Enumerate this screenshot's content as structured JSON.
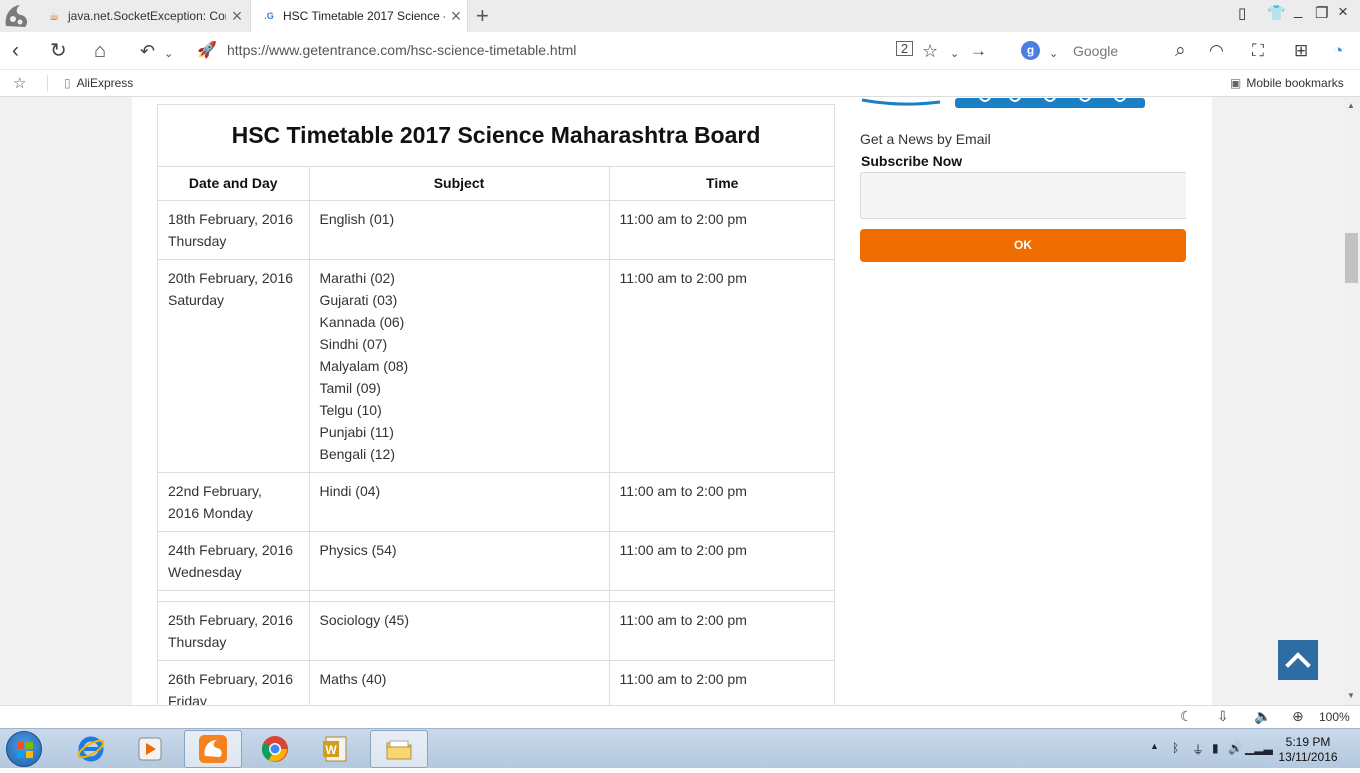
{
  "browser": {
    "tabs": [
      {
        "title": "java.net.SocketException: Cor",
        "favicon": "java-icon"
      },
      {
        "title": "HSC Timetable 2017 Science -",
        "favicon": "getentrance-icon"
      }
    ],
    "url": "https://www.getentrance.com/hsc-science-timetable.html",
    "search_engine_label": "Google",
    "search_engine_letter": "g",
    "tab_counter": "2",
    "bookmarks": [
      "AliExpress"
    ],
    "mobile_bookmarks": "Mobile bookmarks",
    "zoom": "100%"
  },
  "page": {
    "table_title": "HSC Timetable 2017 Science Maharashtra Board",
    "columns": [
      "Date and Day",
      "Subject",
      "Time"
    ],
    "rows": [
      {
        "date": "18th February, 2016",
        "day": "Thursday",
        "subjects": [
          "English (01)"
        ],
        "time": "11:00 am to 2:00 pm"
      },
      {
        "date": "20th February, 2016",
        "day": "Saturday",
        "subjects": [
          "Marathi (02)",
          "Gujarati (03)",
          "Kannada (06)",
          "Sindhi (07)",
          "Malyalam (08)",
          "Tamil (09)",
          "Telgu (10)",
          "Punjabi (11)",
          "Bengali (12)"
        ],
        "time": "11:00 am to 2:00 pm"
      },
      {
        "date": "22nd February,",
        "day": "2016 Monday",
        "subjects": [
          "Hindi (04)"
        ],
        "time": "11:00 am to 2:00 pm"
      },
      {
        "date": "24th February, 2016",
        "day": "Wednesday",
        "subjects": [
          "Physics (54)"
        ],
        "time": "11:00 am to 2:00 pm"
      },
      {
        "date": "25th February, 2016",
        "day": "Thursday",
        "subjects": [
          "Sociology (45)"
        ],
        "time": "11:00 am to 2:00 pm"
      },
      {
        "date": "26th February, 2016",
        "day": "Friday",
        "subjects": [
          "Maths (40)"
        ],
        "time": "11:00 am to 2:00 pm"
      }
    ],
    "sidebar": {
      "news_label": "Get a News by Email",
      "subscribe_label": "Subscribe Now",
      "ok_label": "OK"
    }
  },
  "taskbar": {
    "apps": [
      "internet-explorer-icon",
      "media-player-icon",
      "uc-browser-icon",
      "chrome-icon",
      "word-icon",
      "file-explorer-icon"
    ],
    "clock_time": "5:19 PM",
    "clock_date": "13/11/2016"
  },
  "colors": {
    "accent_orange": "#ef6c00",
    "scroll_top_blue": "#2e6da4",
    "logo_blue": "#1a7fc4"
  }
}
